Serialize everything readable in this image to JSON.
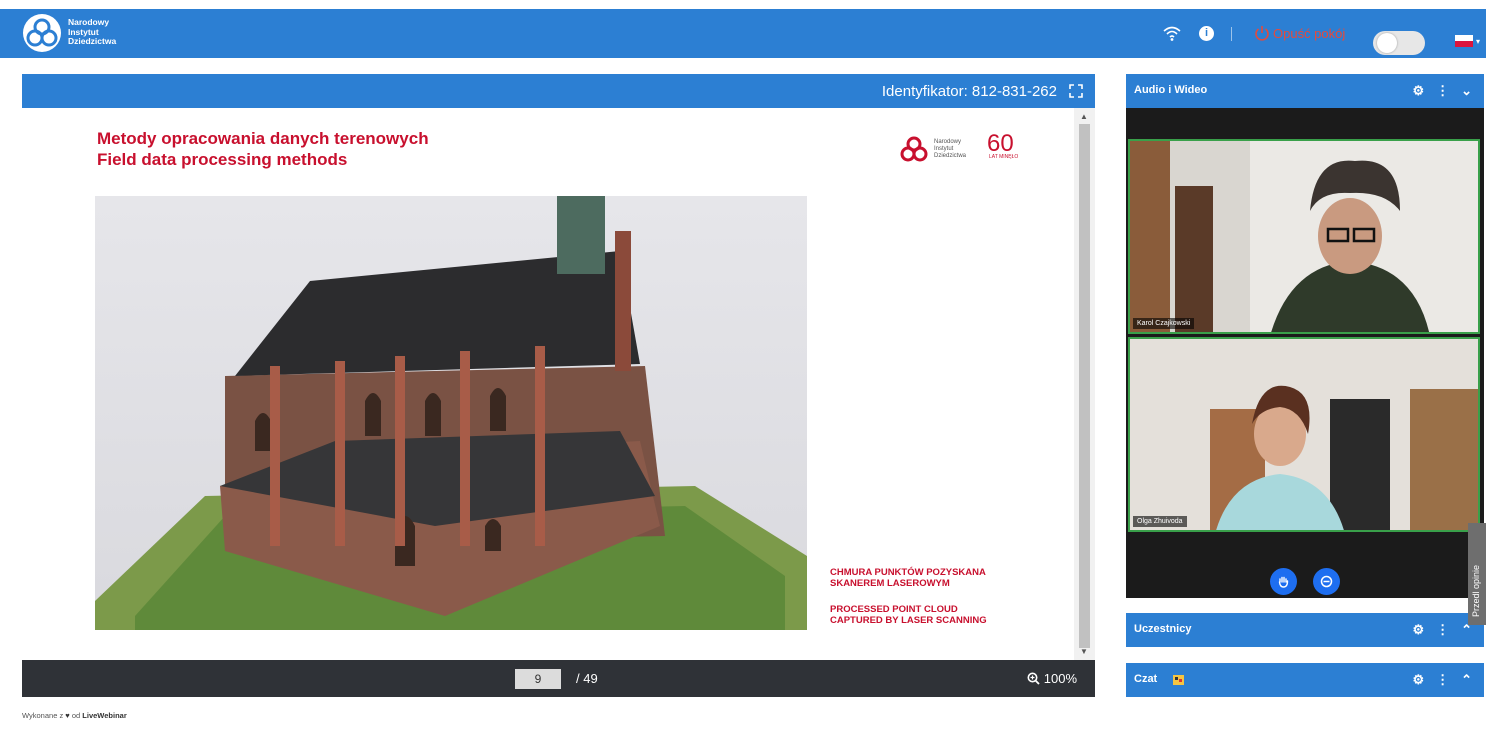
{
  "header": {
    "logo_lines": [
      "Narodowy",
      "Instytut",
      "Dziedzictwa"
    ],
    "leave_label": "Opuść pokój",
    "language": "pl"
  },
  "presentation": {
    "identifier": "Identyfikator: 812-831-262",
    "slide": {
      "title_line1": "Metody opracowania danych terenowych",
      "title_line2": "Field data processing methods",
      "logo_lines": [
        "Narodowy",
        "Instytut",
        "Dziedzictwa"
      ],
      "anniversary": "60",
      "anniversary_sub": "LAT MINĘŁO",
      "caption_pl_1": "CHMURA PUNKTÓW POZYSKANA",
      "caption_pl_2": "SKANEREM LASEROWYM",
      "caption_en_1": "PROCESSED POINT CLOUD",
      "caption_en_2": "CAPTURED BY LASER SCANNING"
    },
    "page_current": "9",
    "page_total": "/ 49",
    "zoom": "100%"
  },
  "panels": {
    "audio_video": "Audio i Wideo",
    "participants": "Uczestnicy",
    "chat": "Czat",
    "tiles": [
      {
        "name": "Karol Czajkowski"
      },
      {
        "name": "Olga Zhuivoda"
      }
    ]
  },
  "feedback_label": "Przedl opinie",
  "footer": {
    "prefix": "Wykonane z",
    "middle": "od",
    "brand": "LiveWebinar"
  },
  "colors": {
    "accent": "#2c7fd3",
    "brand_red": "#c8102e",
    "leave_red": "#e64a3b",
    "video_button": "#1e6ef0",
    "speaking_border": "#39a04a"
  }
}
